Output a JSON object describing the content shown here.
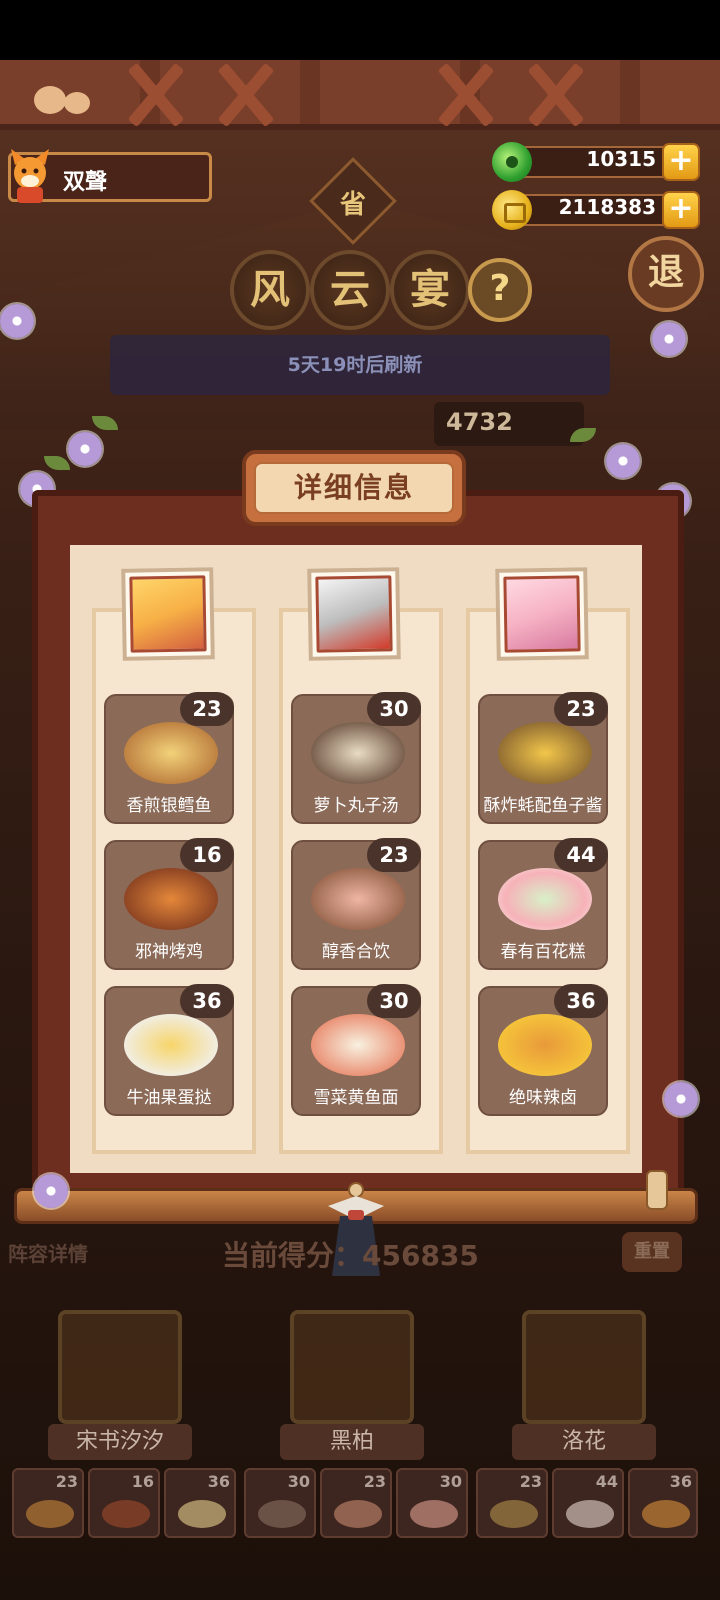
{
  "player": {
    "name": "双聲"
  },
  "currency": {
    "jade": "10315",
    "gold": "2118383",
    "add_label": "+"
  },
  "province_badge": "省",
  "event_title": [
    "风",
    "云",
    "宴"
  ],
  "help_label": "?",
  "exit_label": "退",
  "refresh_text": "5天19时后刷新",
  "score_peek": "4732",
  "modal": {
    "title": "详细信息",
    "columns": [
      {
        "portrait": "character-portrait-1",
        "dishes": [
          {
            "name": "香煎银鳕鱼",
            "count": "23",
            "color": "#e0a14a"
          },
          {
            "name": "邪神烤鸡",
            "count": "16",
            "color": "#b4552e"
          },
          {
            "name": "牛油果蛋挞",
            "count": "36",
            "color": "#efc060"
          }
        ]
      },
      {
        "portrait": "character-portrait-2",
        "dishes": [
          {
            "name": "萝卜丸子汤",
            "count": "30",
            "color": "#cfb89a"
          },
          {
            "name": "醇香合饮",
            "count": "23",
            "color": "#d8a482"
          },
          {
            "name": "雪菜黄鱼面",
            "count": "30",
            "color": "#f1e2c8"
          }
        ]
      },
      {
        "portrait": "character-portrait-3",
        "dishes": [
          {
            "name": "酥炸蚝配鱼子酱",
            "count": "23",
            "color": "#e8c46a"
          },
          {
            "name": "春有百花糕",
            "count": "44",
            "color": "#f6c9c2"
          },
          {
            "name": "绝味辣卤",
            "count": "36",
            "color": "#d47a2e"
          }
        ]
      }
    ]
  },
  "bottom": {
    "lineup_label": "阵容详情",
    "current_score": "当前得分：456835",
    "reset_label": "重置",
    "characters": [
      "宋书汐汐",
      "黑柏",
      "洛花"
    ],
    "mini_dishes": [
      "23",
      "16",
      "36",
      "30",
      "23",
      "30",
      "23",
      "44",
      "36"
    ]
  }
}
